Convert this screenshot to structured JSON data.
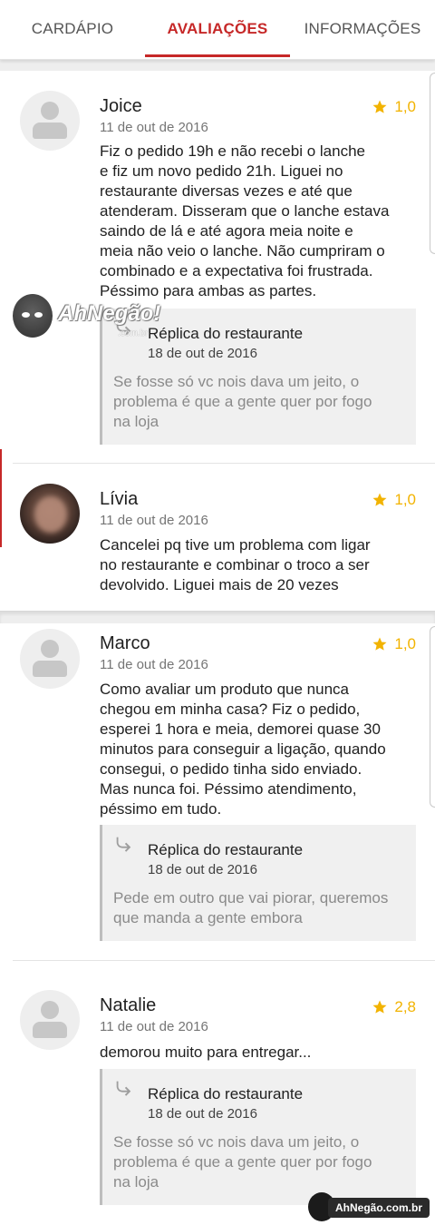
{
  "tabs": [
    {
      "label": "CARDÁPIO",
      "active": false
    },
    {
      "label": "AVALIAÇÕES",
      "active": true
    },
    {
      "label": "INFORMAÇÕES",
      "active": false
    }
  ],
  "colors": {
    "accent": "#c62828",
    "star": "#f2b300"
  },
  "reviews": [
    {
      "name": "Joice",
      "date": "11 de out de 2016",
      "rating": "1,0",
      "lines": [
        "Fiz o pedido 19h e não recebi o lanche",
        "e fiz um novo pedido 21h. Liguei no",
        "restaurante diversas vezes e até que",
        "atenderam. Disseram que o lanche estava",
        "saindo de lá e até agora meia noite e",
        "meia não veio o lanche. Não cumpriram o",
        "combinado e a expectativa foi frustrada.",
        "Péssimo para ambas as partes."
      ],
      "reply": {
        "title": "Réplica do restaurante",
        "date": "18 de out de 2016",
        "lines": [
          "Se fosse só vc nois dava um jeito, o",
          "problema é que a gente quer por fogo",
          "na loja"
        ]
      }
    },
    {
      "name": "Lívia",
      "date": "11 de out de 2016",
      "rating": "1,0",
      "lines": [
        "Cancelei pq tive um problema com ligar",
        "no restaurante e combinar o troco a ser",
        "devolvido. Liguei mais de 20 vezes"
      ]
    },
    {
      "name": "Marco",
      "date": "11 de out de 2016",
      "rating": "1,0",
      "lines": [
        "Como avaliar um produto que nunca",
        "chegou em minha casa? Fiz o pedido,",
        "esperei 1 hora e meia, demorei quase 30",
        "minutos para conseguir a ligação, quando",
        "consegui, o pedido tinha sido enviado.",
        "Mas nunca foi. Péssimo atendimento,",
        "péssimo em tudo."
      ],
      "reply": {
        "title": "Réplica do restaurante",
        "date": "18 de out de 2016",
        "lines": [
          "Pede em outro que vai piorar, queremos",
          "que manda a gente embora"
        ]
      }
    },
    {
      "name": "Natalie",
      "date": "11 de out de 2016",
      "rating": "2,8",
      "lines": [
        "demorou muito para entregar..."
      ],
      "reply": {
        "title": "Réplica do restaurante",
        "date": "18 de out de 2016",
        "lines": [
          "Se fosse só vc nois dava um jeito, o",
          "problema é que a gente quer por fogo",
          "na loja"
        ]
      }
    }
  ],
  "watermark": {
    "main": "AhNegão!",
    "sub": ".com.br",
    "footer": "AhNegão.com.br"
  }
}
